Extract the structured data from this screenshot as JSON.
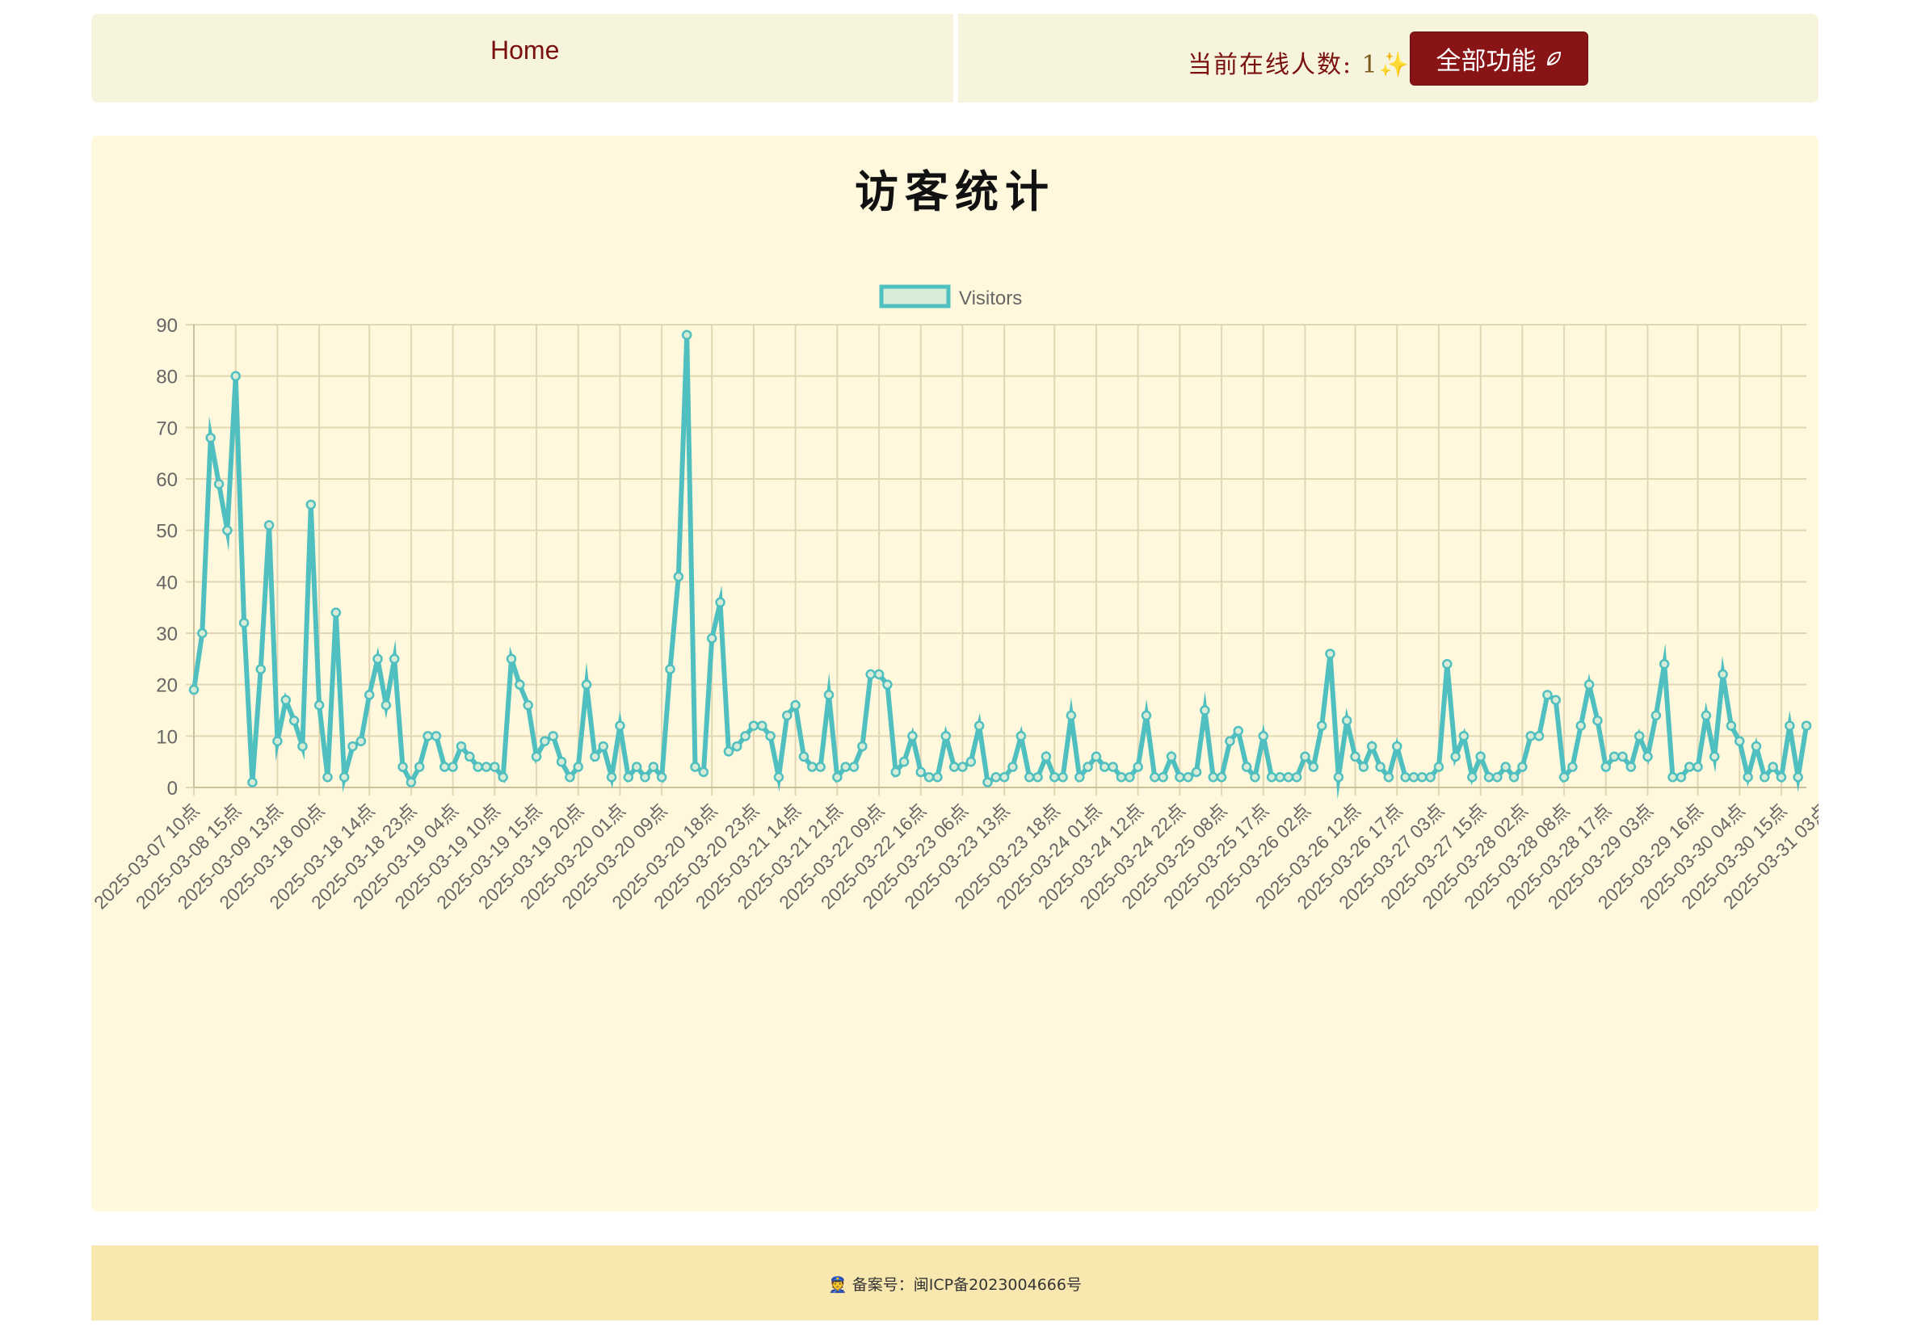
{
  "navbar": {
    "home_label": "Home",
    "online_label": "当前在线人数:",
    "online_count": "1",
    "sparkle": "✨",
    "all_features_label": "全部功能",
    "all_features_icon": "leaf-icon"
  },
  "chart": {
    "heading": "访客统计"
  },
  "chart_data": {
    "type": "line",
    "legend": {
      "label": "Visitors",
      "position": "top-center"
    },
    "grid": true,
    "ylim": [
      0,
      90
    ],
    "y_ticks": [
      0,
      10,
      20,
      30,
      40,
      50,
      60,
      70,
      80,
      90
    ],
    "series": [
      {
        "name": "Visitors",
        "color": "#4fbfbf",
        "values": [
          19,
          30,
          68,
          59,
          50,
          80,
          32,
          1,
          23,
          51,
          9,
          17,
          13,
          8,
          55,
          16,
          2,
          34,
          2,
          8,
          9,
          18,
          25,
          16,
          25,
          4,
          1,
          4,
          10,
          10,
          4,
          4,
          8,
          6,
          4,
          4,
          4,
          2,
          25,
          20,
          16,
          6,
          9,
          10,
          5,
          2,
          4,
          20,
          6,
          8,
          2,
          12,
          2,
          4,
          2,
          4,
          2,
          23,
          41,
          88,
          4,
          3,
          29,
          36,
          7,
          8,
          10,
          12,
          12,
          10,
          2,
          14,
          16,
          6,
          4,
          4,
          18,
          2,
          4,
          4,
          8,
          22,
          22,
          20,
          3,
          5,
          10,
          3,
          2,
          2,
          10,
          4,
          4,
          5,
          12,
          1,
          2,
          2,
          4,
          10,
          2,
          2,
          6,
          2,
          2,
          14,
          2,
          4,
          6,
          4,
          4,
          2,
          2,
          4,
          14,
          2,
          2,
          6,
          2,
          2,
          3,
          15,
          2,
          2,
          9,
          11,
          4,
          2,
          10,
          2,
          2,
          2,
          2,
          6,
          4,
          12,
          26,
          2,
          13,
          6,
          4,
          8,
          4,
          2,
          8,
          2,
          2,
          2,
          2,
          4,
          24,
          6,
          10,
          2,
          6,
          2,
          2,
          4,
          2,
          4,
          10,
          10,
          18,
          17,
          2,
          4,
          12,
          20,
          13,
          4,
          6,
          6,
          4,
          10,
          6,
          14,
          24,
          2,
          2,
          4,
          4,
          14,
          6,
          22,
          12,
          9,
          2,
          8,
          2,
          4,
          2,
          12,
          2,
          12
        ]
      }
    ],
    "x_tick_labels": [
      "2025-03-07 10点",
      "2025-03-08 15点",
      "2025-03-09 13点",
      "2025-03-18 00点",
      "2025-03-18 14点",
      "2025-03-18 23点",
      "2025-03-19 04点",
      "2025-03-19 10点",
      "2025-03-19 15点",
      "2025-03-19 20点",
      "2025-03-20 01点",
      "2025-03-20 09点",
      "2025-03-20 18点",
      "2025-03-20 23点",
      "2025-03-21 14点",
      "2025-03-21 21点",
      "2025-03-22 09点",
      "2025-03-22 16点",
      "2025-03-23 06点",
      "2025-03-23 13点",
      "2025-03-23 18点",
      "2025-03-24 01点",
      "2025-03-24 12点",
      "2025-03-24 22点",
      "2025-03-25 08点",
      "2025-03-25 17点",
      "2025-03-26 02点",
      "2025-03-26 12点",
      "2025-03-26 17点",
      "2025-03-27 03点",
      "2025-03-27 15点",
      "2025-03-28 02点",
      "2025-03-28 08点",
      "2025-03-28 17点",
      "2025-03-29 03点",
      "2025-03-29 16点",
      "2025-03-30 04点",
      "2025-03-30 15点",
      "2025-03-31 03点"
    ]
  },
  "footer": {
    "icon": "police-badge-icon",
    "record_text": "备案号：闽ICP备2023004666号"
  }
}
